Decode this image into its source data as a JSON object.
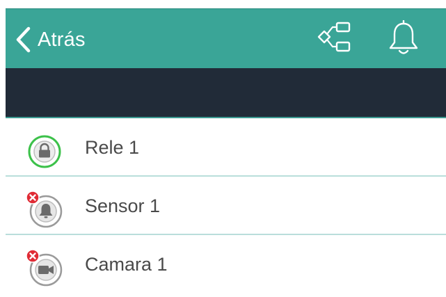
{
  "header": {
    "back_label": "Atrás",
    "back_icon": "chevron-left-icon",
    "actions": [
      {
        "icon": "rules-flow-icon"
      },
      {
        "icon": "bell-icon"
      }
    ],
    "color": "#3aa597"
  },
  "subheader": {
    "color": "#212b38"
  },
  "devices": [
    {
      "label": "Rele 1",
      "icon": "lock-icon",
      "status": "online",
      "status_color": "#3cc14a"
    },
    {
      "label": "Sensor 1",
      "icon": "bell-icon",
      "status": "offline",
      "status_color": "#e02b35"
    },
    {
      "label": "Camara 1",
      "icon": "video-camera-icon",
      "status": "offline",
      "status_color": "#e02b35"
    }
  ]
}
